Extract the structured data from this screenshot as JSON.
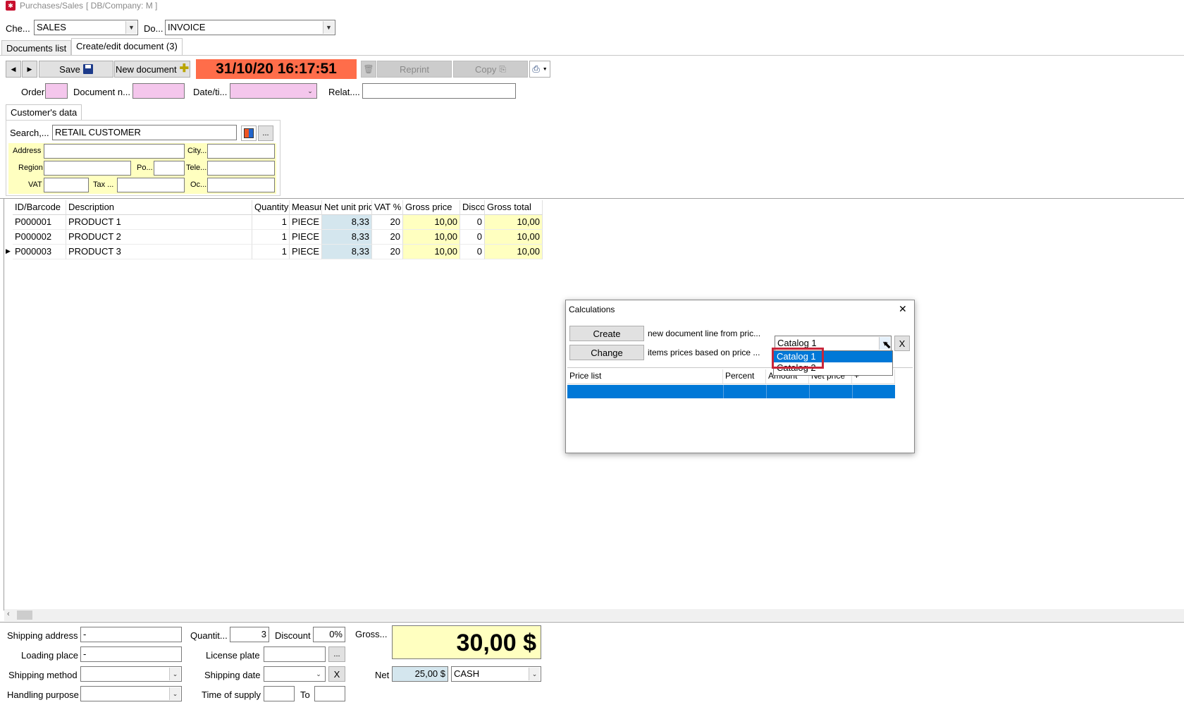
{
  "window": {
    "title": "Purchases/Sales",
    "subtitle": "[ DB/Company: M ]"
  },
  "top": {
    "che_label": "Che...",
    "che_value": "SALES",
    "do_label": "Do...",
    "do_value": "INVOICE"
  },
  "tabs": [
    "Documents list",
    "Create/edit document (3)"
  ],
  "toolbar": {
    "prev": "◀",
    "next": "▶",
    "save_label": "Save",
    "new_doc_label": "New document",
    "datetime": "31/10/20 16:17:51",
    "reprint_label": "Reprint",
    "copy_label": "Copy",
    "datetime_bg": "#ff6d4a"
  },
  "header_fields": {
    "order_label": "Order",
    "docnum_label": "Document n...",
    "datetime_label": "Date/ti...",
    "relat_label": "Relat...."
  },
  "customer": {
    "tab_label": "Customer's data",
    "search_label": "Search,...",
    "search_value": "RETAIL CUSTOMER",
    "ellipsis": "...",
    "address_label": "Address",
    "city_label": "City...",
    "region_label": "Region",
    "po_label": "Po...",
    "tele_label": "Tele...",
    "vat_label": "VAT",
    "tax_label": "Tax ...",
    "oc_label": "Oc..."
  },
  "grid": {
    "headers": [
      "ID/Barcode",
      "Description",
      "Quantity",
      "Measur",
      "Net unit pric",
      "VAT %",
      "Gross price",
      "Disco",
      "Gross total"
    ],
    "rows": [
      {
        "id": "P000001",
        "desc": "PRODUCT 1",
        "qty": "1",
        "measure": "PIECE",
        "net": "8,33",
        "vat": "20",
        "gross": "10,00",
        "disc": "0",
        "total": "10,00"
      },
      {
        "id": "P000002",
        "desc": "PRODUCT 2",
        "qty": "1",
        "measure": "PIECE",
        "net": "8,33",
        "vat": "20",
        "gross": "10,00",
        "disc": "0",
        "total": "10,00"
      },
      {
        "id": "P000003",
        "desc": "PRODUCT 3",
        "qty": "1",
        "measure": "PIECE",
        "net": "8,33",
        "vat": "20",
        "gross": "10,00",
        "disc": "0",
        "total": "10,00"
      }
    ],
    "current_row_marker": "▶"
  },
  "dialog": {
    "title": "Calculations",
    "close": "✕",
    "create_label": "Create",
    "create_text": "new document line from pric...",
    "change_label": "Change",
    "change_text": "items prices based on price ...",
    "catalog_value": "Catalog 1",
    "clear_label": "X",
    "dropdown_options": [
      "Catalog 1",
      "Catalog 2"
    ],
    "table_headers": [
      "Price list",
      "Percent",
      "Amount",
      "Net price",
      "+"
    ]
  },
  "footer": {
    "shipping_address_label": "Shipping address",
    "shipping_address_value": "-",
    "loading_place_label": "Loading place",
    "loading_place_value": "-",
    "shipping_method_label": "Shipping method",
    "handling_purpose_label": "Handling purpose",
    "quantity_label": "Quantit...",
    "quantity_value": "3",
    "discount_label": "Discount",
    "discount_value": "0%",
    "license_plate_label": "License plate",
    "license_ellipsis": "...",
    "shipping_date_label": "Shipping date",
    "shipping_date_clear": "X",
    "time_supply_label": "Time of supply",
    "to_label": "To",
    "gross_label": "Gross...",
    "gross_value": "30,00 $",
    "net_label": "Net",
    "net_value": "25,00 $",
    "payment_value": "CASH"
  }
}
